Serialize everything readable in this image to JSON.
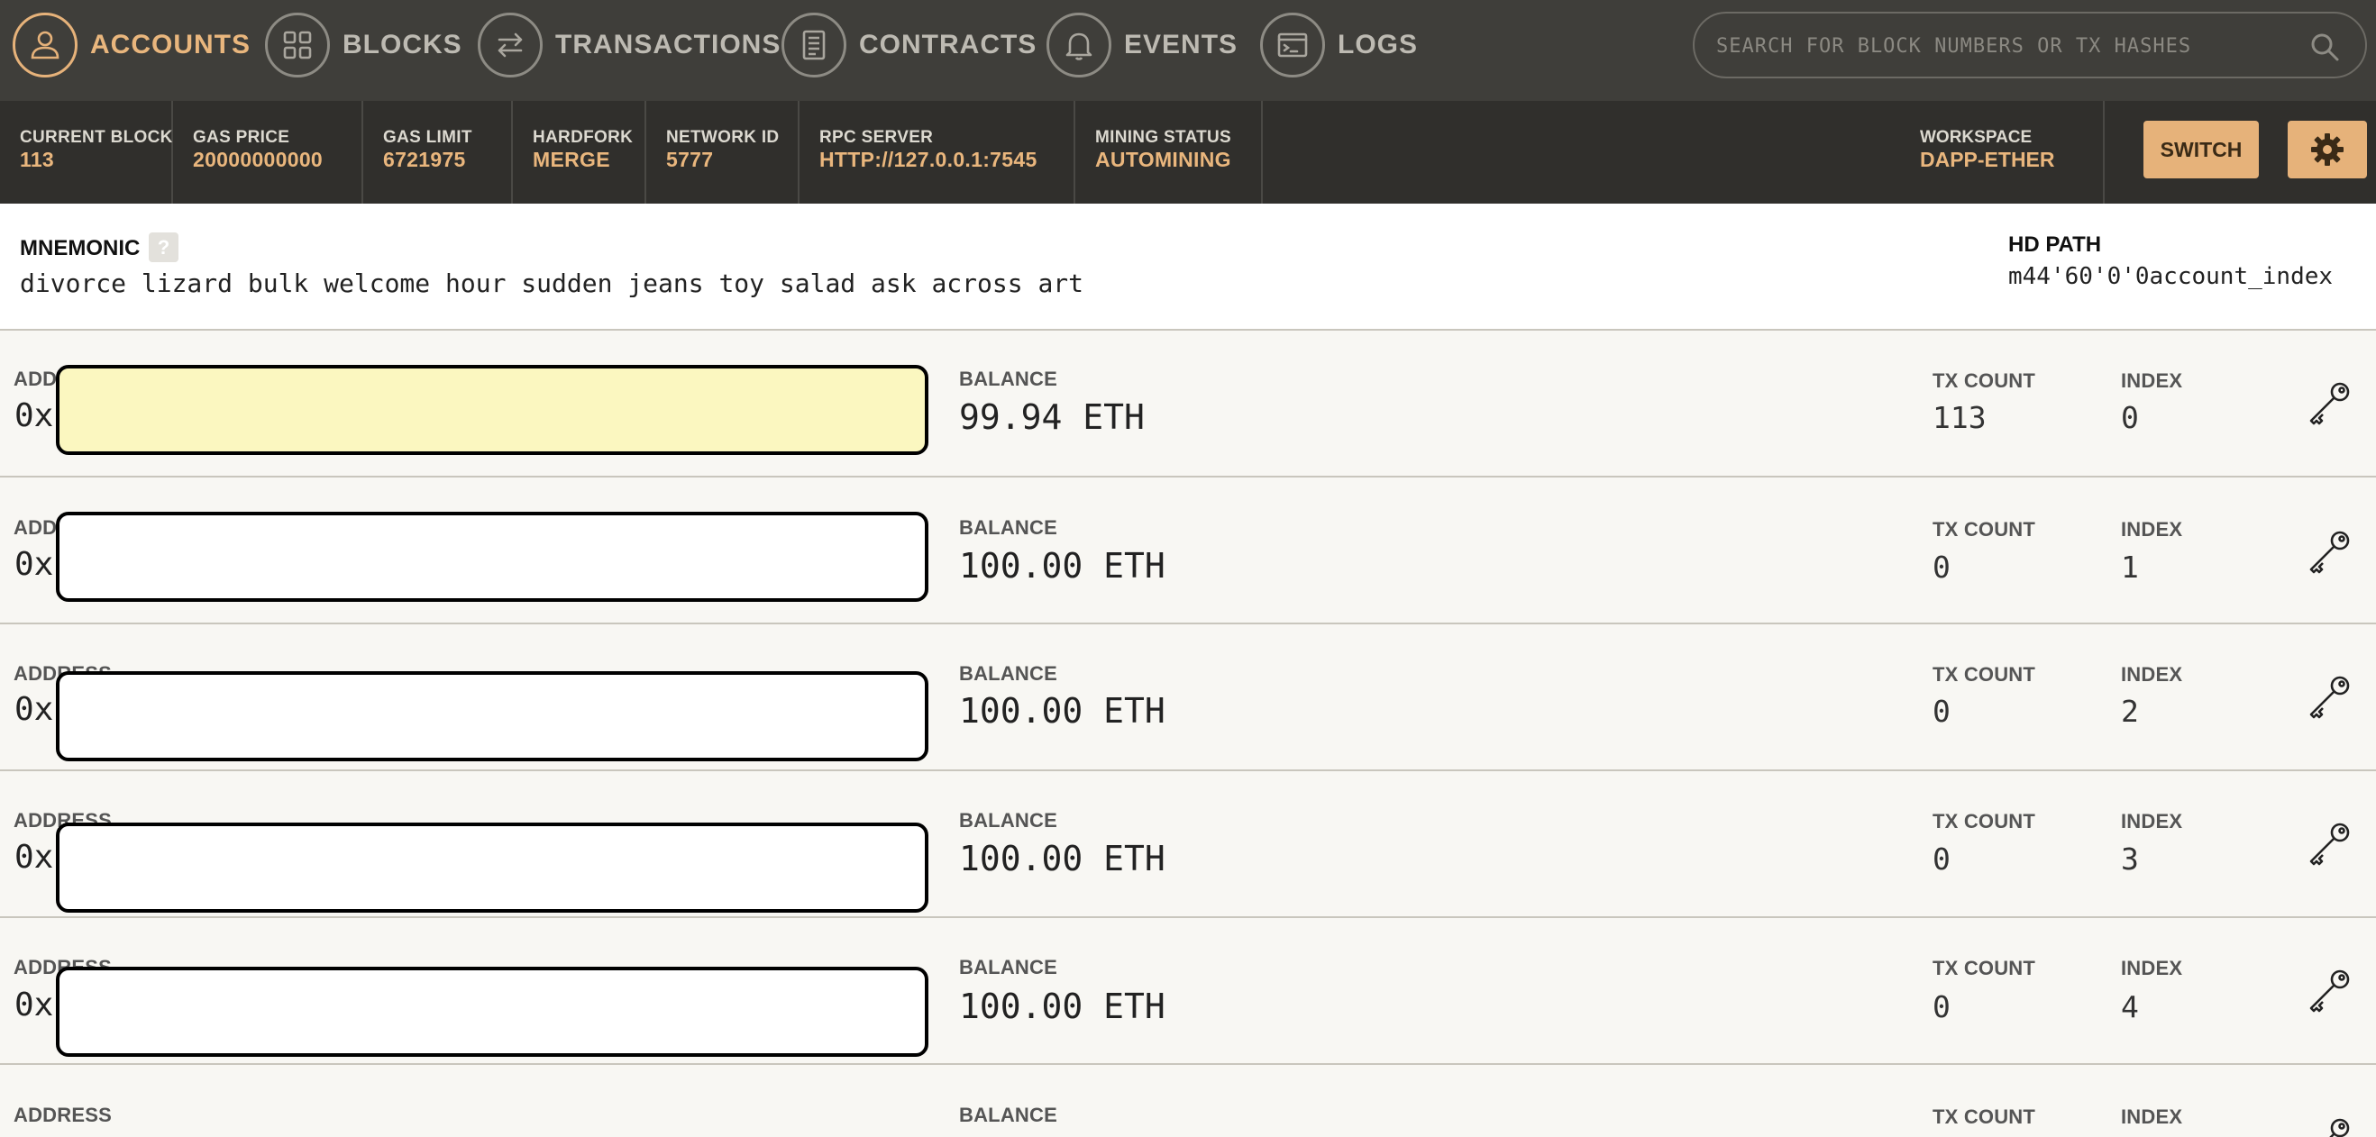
{
  "nav": {
    "items": [
      {
        "label": "ACCOUNTS",
        "icon": "user-icon",
        "active": true
      },
      {
        "label": "BLOCKS",
        "icon": "grid-icon",
        "active": false
      },
      {
        "label": "TRANSACTIONS",
        "icon": "swap-arrows-icon",
        "active": false
      },
      {
        "label": "CONTRACTS",
        "icon": "document-icon",
        "active": false
      },
      {
        "label": "EVENTS",
        "icon": "bell-icon",
        "active": false
      },
      {
        "label": "LOGS",
        "icon": "terminal-icon",
        "active": false
      }
    ],
    "search_placeholder": "SEARCH FOR BLOCK NUMBERS OR TX HASHES"
  },
  "status": {
    "current_block": {
      "label": "CURRENT BLOCK",
      "value": "113"
    },
    "gas_price": {
      "label": "GAS PRICE",
      "value": "20000000000"
    },
    "gas_limit": {
      "label": "GAS LIMIT",
      "value": "6721975"
    },
    "hardfork": {
      "label": "HARDFORK",
      "value": "MERGE"
    },
    "network_id": {
      "label": "NETWORK ID",
      "value": "5777"
    },
    "rpc_server": {
      "label": "RPC SERVER",
      "value": "HTTP://127.0.0.1:7545"
    },
    "mining_status": {
      "label": "MINING STATUS",
      "value": "AUTOMINING"
    },
    "workspace": {
      "label": "WORKSPACE",
      "value": "DAPP-ETHER"
    },
    "switch_label": "SWITCH"
  },
  "mnemonic": {
    "label": "MNEMONIC",
    "help": "?",
    "words": "divorce lizard bulk welcome hour sudden jeans toy salad ask across art",
    "hd_path_label": "HD PATH",
    "hd_path_value": "m44'60'0'0account_index"
  },
  "accounts": [
    {
      "address_label": "ADDRESS",
      "address_prefix": "0x",
      "balance_label": "BALANCE",
      "balance": "99.94 ETH",
      "tx_count_label": "TX COUNT",
      "tx_count": "113",
      "index_label": "INDEX",
      "index": "0"
    },
    {
      "address_label": "ADDRESS",
      "address_prefix": "0x",
      "balance_label": "BALANCE",
      "balance": "100.00 ETH",
      "tx_count_label": "TX COUNT",
      "tx_count": "0",
      "index_label": "INDEX",
      "index": "1"
    },
    {
      "address_label": "ADDRESS",
      "address_prefix": "0x",
      "balance_label": "BALANCE",
      "balance": "100.00 ETH",
      "tx_count_label": "TX COUNT",
      "tx_count": "0",
      "index_label": "INDEX",
      "index": "2"
    },
    {
      "address_label": "ADDRESS",
      "address_prefix": "0x",
      "balance_label": "BALANCE",
      "balance": "100.00 ETH",
      "tx_count_label": "TX COUNT",
      "tx_count": "0",
      "index_label": "INDEX",
      "index": "3"
    },
    {
      "address_label": "ADDRESS",
      "address_prefix": "0x",
      "balance_label": "BALANCE",
      "balance": "100.00 ETH",
      "tx_count_label": "TX COUNT",
      "tx_count": "0",
      "index_label": "INDEX",
      "index": "4"
    },
    {
      "address_label": "ADDRESS",
      "address_prefix": "",
      "balance_label": "BALANCE",
      "balance": "",
      "tx_count_label": "TX COUNT",
      "tx_count": "",
      "index_label": "INDEX",
      "index": ""
    }
  ],
  "colors": {
    "nav_bg": "#3f3e3a",
    "status_bg": "#302f2c",
    "accent": "#e6b27a",
    "highlight": "#fbf7c0"
  }
}
